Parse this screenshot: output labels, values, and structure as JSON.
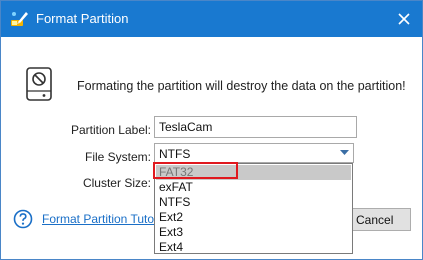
{
  "window": {
    "title": "Format Partition"
  },
  "icons": {
    "app": "partition-wizard-icon",
    "close": "close-icon",
    "warning": "drive-no-entry-icon",
    "help": "help-icon",
    "dropdown": "chevron-down-icon"
  },
  "colors": {
    "titlebar": "#1979d0",
    "link": "#1a6fc7",
    "highlight": "#e0191f"
  },
  "warning": {
    "text": "Formating the partition will destroy the data on the partition!"
  },
  "form": {
    "partition_label": {
      "label": "Partition Label:",
      "value": "TeslaCam"
    },
    "file_system": {
      "label": "File System:",
      "value": "NTFS"
    },
    "cluster_size": {
      "label": "Cluster Size:"
    }
  },
  "dropdown": {
    "options": [
      "FAT32",
      "exFAT",
      "NTFS",
      "Ext2",
      "Ext3",
      "Ext4"
    ],
    "hovered": "FAT32"
  },
  "footer": {
    "help_link": "Format Partition Tutorial",
    "cancel_label": "Cancel"
  }
}
